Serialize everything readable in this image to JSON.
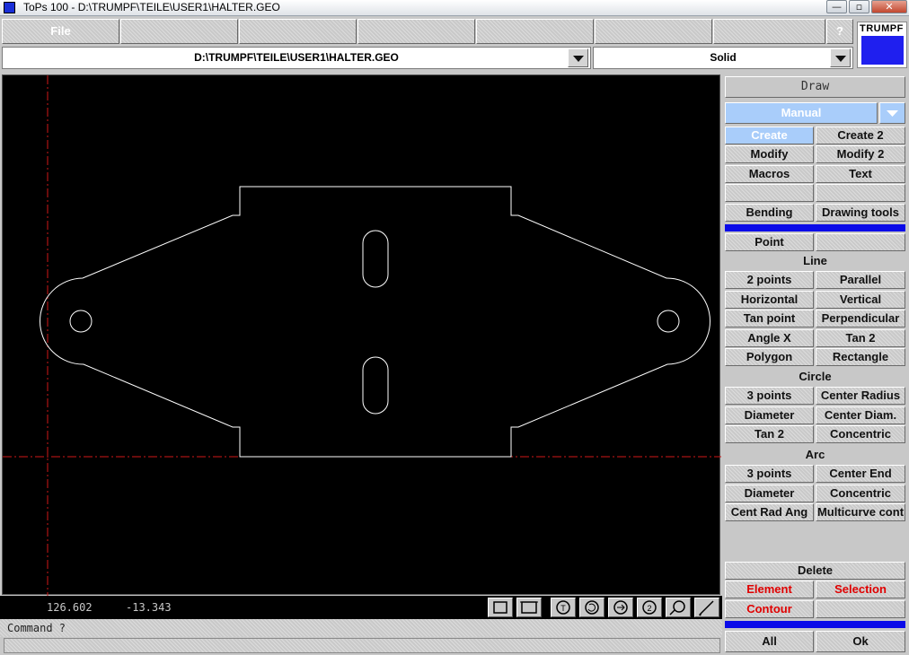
{
  "window": {
    "title": "ToPs 100 - D:\\TRUMPF\\TEILE\\USER1\\HALTER.GEO",
    "min_glyph": "—",
    "max_glyph": "▫",
    "close_glyph": "✕"
  },
  "menu": {
    "items": [
      "File",
      "",
      "",
      "",
      "",
      "",
      ""
    ],
    "help": "?"
  },
  "logo": {
    "text": "TRUMPF",
    "color": "#1f1fef"
  },
  "file_path": "D:\\TRUMPF\\TEILE\\USER1\\HALTER.GEO",
  "line_style": "Solid",
  "status": {
    "x": "126.602",
    "y": "-13.343",
    "tool_icons": [
      "rect-select-icon",
      "rect-frame-icon",
      "zoom-t-icon",
      "zoom-rotate-icon",
      "zoom-arrow-icon",
      "zoom-2-icon",
      "zoom-lasso-icon",
      "pencil-icon"
    ]
  },
  "command": {
    "prompt": "Command ?",
    "value": ""
  },
  "panel": {
    "header": "Draw",
    "mode": "Manual",
    "tabs": [
      [
        "Create",
        "Create 2"
      ],
      [
        "Modify",
        "Modify 2"
      ],
      [
        "Macros",
        "Text"
      ],
      [
        "",
        ""
      ],
      [
        "Bending",
        "Drawing tools"
      ]
    ],
    "point_row": [
      "Point",
      ""
    ],
    "line": {
      "title": "Line",
      "rows": [
        [
          "2 points",
          "Parallel"
        ],
        [
          "Horizontal",
          "Vertical"
        ],
        [
          "Tan point",
          "Perpendicular"
        ],
        [
          "Angle X",
          "Tan 2"
        ],
        [
          "Polygon",
          "Rectangle"
        ]
      ]
    },
    "circle": {
      "title": "Circle",
      "rows": [
        [
          "3 points",
          "Center Radius"
        ],
        [
          "Diameter",
          "Center Diam."
        ],
        [
          "Tan 2",
          "Concentric"
        ]
      ]
    },
    "arc": {
      "title": "Arc",
      "rows": [
        [
          "3 points",
          "Center End"
        ],
        [
          "Diameter",
          "Concentric"
        ],
        [
          "Cent Rad Ang",
          "Multicurve cont"
        ]
      ]
    },
    "delete": {
      "title": "Delete",
      "rows": [
        [
          "Element",
          "Selection"
        ],
        [
          "Contour",
          ""
        ]
      ]
    },
    "bottom": [
      "All",
      "Ok"
    ]
  },
  "colors": {
    "canvas_bg": "#000000",
    "geometry": "#ffffff",
    "axis": "#d01818",
    "accent_blue": "#0a0ae8",
    "selected_tab": "#a9cdfa",
    "delete_text": "#e00000"
  }
}
